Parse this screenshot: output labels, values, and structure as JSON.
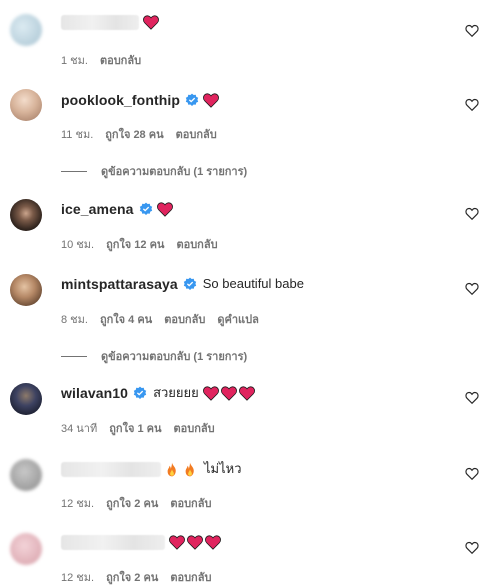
{
  "comments": [
    {
      "username": "",
      "blurred": true,
      "name_width": 78,
      "text": "",
      "hearts": 1,
      "time": "1 ชม.",
      "likes": "",
      "reply": "ตอบกลับ",
      "translate": "",
      "avatar_colors": [
        "#d6e6ee",
        "#b9d0dc"
      ]
    },
    {
      "username": "pooklook_fonthip",
      "blurred": false,
      "verified": true,
      "text": "",
      "hearts": 1,
      "time": "11 ชม.",
      "likes": "ถูกใจ 28 คน",
      "reply": "ตอบกลับ",
      "translate": "",
      "avatar_colors": [
        "#e9c8b3",
        "#b98d74"
      ],
      "view_replies": "ดูข้อความตอบกลับ (1 รายการ)"
    },
    {
      "username": "ice_amena",
      "blurred": false,
      "verified": true,
      "text": "",
      "hearts": 1,
      "time": "10 ชม.",
      "likes": "ถูกใจ 12 คน",
      "reply": "ตอบกลับ",
      "translate": "",
      "avatar_colors": [
        "#6b5547",
        "#2b211c"
      ]
    },
    {
      "username": "mintspattarasaya",
      "blurred": false,
      "verified": true,
      "text": "So beautiful babe",
      "hearts": 0,
      "time": "8 ชม.",
      "likes": "ถูกใจ 4 คน",
      "reply": "ตอบกลับ",
      "translate": "ดูคำแปล",
      "avatar_colors": [
        "#c9a27f",
        "#6e5038"
      ],
      "view_replies": "ดูข้อความตอบกลับ (1 รายการ)"
    },
    {
      "username": "wilavan10",
      "blurred": false,
      "verified": true,
      "text": "สวยยยย",
      "hearts": 3,
      "time": "34 นาที",
      "likes": "ถูกใจ 1 คน",
      "reply": "ตอบกลับ",
      "translate": "",
      "avatar_colors": [
        "#39405a",
        "#151823"
      ]
    },
    {
      "username": "",
      "blurred": true,
      "name_width": 100,
      "text": "ไม่ไหว",
      "fires": 2,
      "hearts": 0,
      "time": "12 ชม.",
      "likes": "ถูกใจ 2 คน",
      "reply": "ตอบกลับ",
      "translate": "",
      "avatar_colors": [
        "#bdbdbd",
        "#8a8a8a"
      ]
    },
    {
      "username": "",
      "blurred": true,
      "name_width": 104,
      "text": "",
      "hearts": 3,
      "time": "12 ชม.",
      "likes": "ถูกใจ 2 คน",
      "reply": "ตอบกลับ",
      "translate": "",
      "avatar_colors": [
        "#efc9cf",
        "#d9a6ae"
      ]
    }
  ],
  "icons": {
    "like": "heart-outline-icon",
    "verified": "verified-badge-icon",
    "heart_emoji": "red-heart-emoji",
    "fire_emoji": "fire-emoji"
  },
  "colors": {
    "verified": "#3897f0",
    "heart": "#e0245e",
    "meta_text": "#737373"
  }
}
